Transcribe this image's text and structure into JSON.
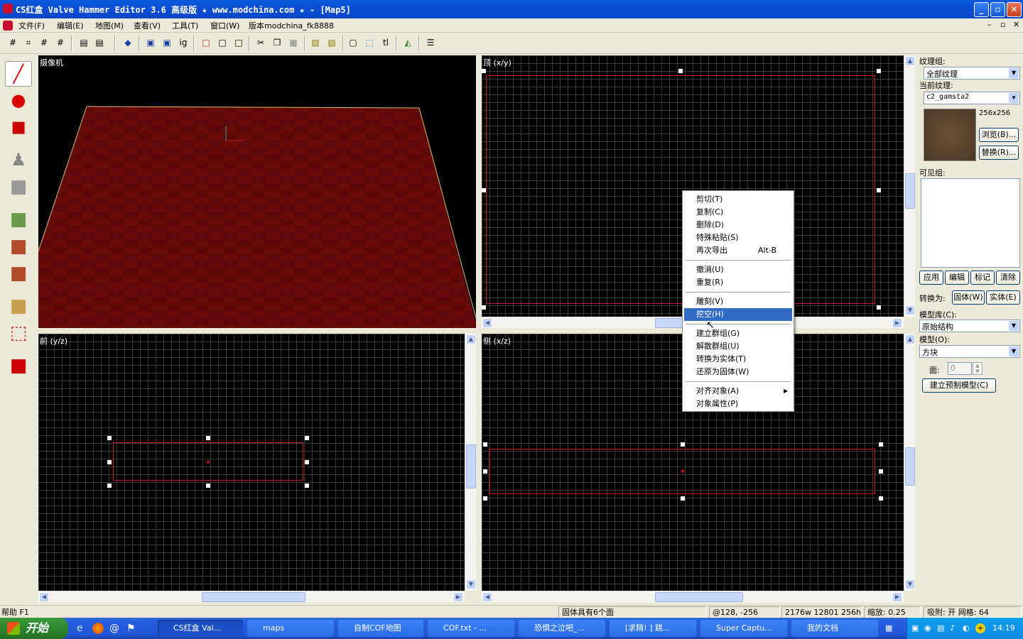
{
  "window": {
    "title": "CS红盒 Valve Hammer Editor 3.6 高级版 ★ www.modchina.com ★ - [Map5]"
  },
  "menu": {
    "items": [
      "文件(F)",
      "编辑(E)",
      "地图(M)",
      "查看(V)",
      "工具(T)",
      "窗口(W)",
      "版本modchina_fk8888"
    ]
  },
  "views": {
    "camera": "摄像机",
    "top": "顶 (x/y)",
    "front": "前 (y/z)",
    "side": "侧 (x/z)"
  },
  "texture_panel": {
    "group_label": "纹理组:",
    "group_value": "全部纹理",
    "current_label": "当前纹理:",
    "current_value": "c2_gamsta2",
    "size": "256x256",
    "browse": "浏览(B)...",
    "replace": "替换(R)...",
    "visgroup_label": "可见组:",
    "apply": "应用",
    "edit": "编辑",
    "mark": "标记",
    "clear": "清除",
    "convert_label": "转换为:",
    "to_solid": "固体(W)",
    "to_entity": "实体(E)",
    "prefab_lib_label": "模型库(C):",
    "prefab_lib_value": "原始结构",
    "prefab_label": "模型(O):",
    "prefab_value": "方块",
    "faces_label": "面:",
    "faces_value": "0",
    "create_prefab": "建立预制模型(C)"
  },
  "context_menu": {
    "items": [
      {
        "label": "剪切(T)",
        "shortcut": ""
      },
      {
        "label": "复制(C)",
        "shortcut": ""
      },
      {
        "label": "删除(D)",
        "shortcut": ""
      },
      {
        "label": "特殊粘贴(S)",
        "shortcut": ""
      },
      {
        "label": "再次导出",
        "shortcut": "Alt-B"
      },
      {
        "label": "撤消(U)",
        "shortcut": ""
      },
      {
        "label": "重复(R)",
        "shortcut": ""
      },
      {
        "label": "雕刻(V)",
        "shortcut": ""
      },
      {
        "label": "挖空(H)",
        "shortcut": ""
      },
      {
        "label": "建立群组(G)",
        "shortcut": ""
      },
      {
        "label": "解散群组(U)",
        "shortcut": ""
      },
      {
        "label": "转换为实体(T)",
        "shortcut": ""
      },
      {
        "label": "还原为固体(W)",
        "shortcut": ""
      },
      {
        "label": "对齐对象(A)",
        "shortcut": ""
      },
      {
        "label": "对象属性(P)",
        "shortcut": ""
      }
    ],
    "highlighted": "挖空(H)"
  },
  "status": {
    "help": "帮助 F1",
    "selection": "固体具有6个面",
    "coords": "@128, -256",
    "dimensions": "2176w 12801 256h",
    "zoom": "缩放: 0.25",
    "snap": "吸附: 开 网格: 64"
  },
  "taskbar": {
    "start": "开始",
    "tasks": [
      "CS红盒 Val...",
      "maps",
      "自制COF地图",
      "COF.txt - ...",
      "恐惧之泣吧_...",
      "[求精! ] 跳...",
      "Super Captu...",
      "我的文档"
    ],
    "clock": "14:19"
  },
  "colors": {
    "accent": "#316ac5",
    "brush_outline": "#c81c1c",
    "floor": "#6b0a0a"
  }
}
